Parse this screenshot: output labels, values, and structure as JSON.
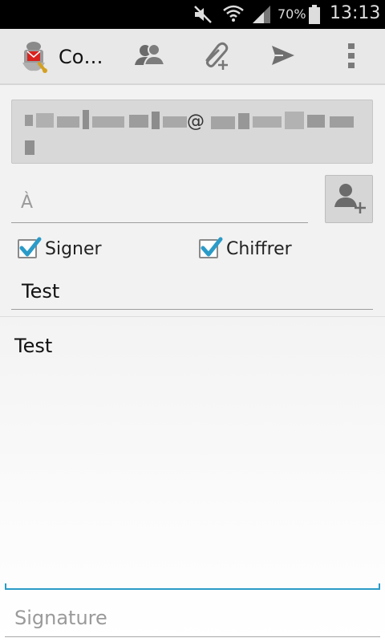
{
  "status_bar": {
    "battery_percent": "70%",
    "time": "13:13",
    "icons": [
      "muted-icon",
      "wifi-icon",
      "signal-icon",
      "battery-icon"
    ]
  },
  "action_bar": {
    "title": "Co…",
    "actions": [
      "contacts-icon",
      "attach-icon",
      "send-icon",
      "overflow-menu-icon"
    ]
  },
  "compose": {
    "from_partial": "@",
    "to_placeholder": "À",
    "sign_label": "Signer",
    "sign_checked": true,
    "encrypt_label": "Chiffrer",
    "encrypt_checked": true,
    "subject": "Test",
    "body": "Test",
    "signature_placeholder": "Signature"
  },
  "colors": {
    "accent": "#2a9bc8",
    "check": "#2a9bc8"
  }
}
